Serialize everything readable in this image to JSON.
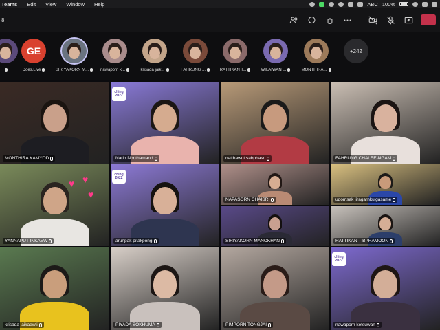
{
  "menubar": {
    "app_name": "Teams",
    "menus": [
      "Edit",
      "View",
      "Window",
      "Help"
    ],
    "input_source": "ABC",
    "battery": "100%"
  },
  "toolbar": {
    "participant_count": "8",
    "more_badge": "+242"
  },
  "strip": [
    {
      "label": "",
      "initials": "",
      "bg": "#5b4a7a"
    },
    {
      "label": "Does.Live",
      "initials": "GE",
      "bg": "#d9412f"
    },
    {
      "label": "SIRIYAKORN M...",
      "initials": "",
      "bg": "#6a7380",
      "active": true
    },
    {
      "label": "nawaporn k...",
      "initials": "",
      "bg": "#a98c8c"
    },
    {
      "label": "krisada jaik...",
      "initials": "",
      "bg": "#c3a58a"
    },
    {
      "label": "FAHRUNG ...",
      "initials": "",
      "bg": "#7a4a3a"
    },
    {
      "label": "RATTIKAN T...",
      "initials": "",
      "bg": "#8a6a6a"
    },
    {
      "label": "WILAIWAN ...",
      "initials": "",
      "bg": "#7a6ab0"
    },
    {
      "label": "MONTHIRA...",
      "initials": "",
      "bg": "#9c7a5a"
    }
  ],
  "tiles": [
    {
      "name": "MONTHIRA KAMYOD",
      "bg": "#3a2a24",
      "skin": "#c9a08a",
      "hair": "#1a1410",
      "shirt": "#1d1d22"
    },
    {
      "name": "Narin Nonthamand",
      "bg": "#8a7ad8",
      "skin": "#d5ab8f",
      "hair": "#1b1614",
      "shirt": "#e9b3ad"
    },
    {
      "name": "natthawut sabphaso",
      "bg": "#b89a78",
      "skin": "#c79a7e",
      "hair": "#1a1a1a",
      "shirt": "#b23b44"
    },
    {
      "name": "FAHRUNG CHALEE-NGAM",
      "bg": "#cbbfb4",
      "skin": "#d9b29e",
      "hair": "#1b1413",
      "shirt": "#e8e0dc"
    },
    {
      "name": "YANNAPUT INKAEW",
      "bg": "#7a8a5a",
      "skin": "#cfa588",
      "hair": "#2a2420",
      "shirt": "#e8e6e2"
    },
    {
      "name": "arunpak pitakpong",
      "bg": "#8d7ad6",
      "skin": "#d8b098",
      "hair": "#161210",
      "shirt": "#2e3550"
    },
    {
      "name": "NAPASORN CHAISRI",
      "bg": "#b0908a",
      "skin": "#d6ac92",
      "hair": "#221815",
      "shirt": "#b98a74"
    },
    {
      "name": "udomsak jiragarnkulgasame",
      "bg": "#d9c080",
      "skin": "#c89a7a",
      "hair": "#1c1a18",
      "shirt": "#2b47a8"
    },
    {
      "name": "krisada jaikaewti",
      "bg": "#5a7a50",
      "skin": "#c99e7c",
      "hair": "#1c1a18",
      "shirt": "#e8c21e"
    },
    {
      "name": "PIYADA SOKHUMA",
      "bg": "#d8cfc8",
      "skin": "#dcbaa4",
      "hair": "#1c1614",
      "shirt": "#c9c1bd"
    },
    {
      "name": "SIRIYAKORN MANOKHAN",
      "bg": "#5a4a8a",
      "skin": "#c8a090",
      "hair": "#141010",
      "shirt": "#2a2a35"
    },
    {
      "name": "RATTIKAN TIBPRAMOON",
      "bg": "#c9c3bd",
      "skin": "#d5ae96",
      "hair": "#1a1412",
      "shirt": "#2c3e6a"
    },
    {
      "name": "PIMPORN TONGJAI",
      "bg": "#b4a8a0",
      "skin": "#c49a88",
      "hair": "#2a1c18",
      "shirt": "#5a4a44"
    },
    {
      "name": "nawaporn ketsuwan",
      "bg": "#7e6ad0",
      "skin": "#d3ae98",
      "hair": "#1e1614",
      "shirt": "#3a3040"
    }
  ],
  "event_logo": "ching 2022"
}
